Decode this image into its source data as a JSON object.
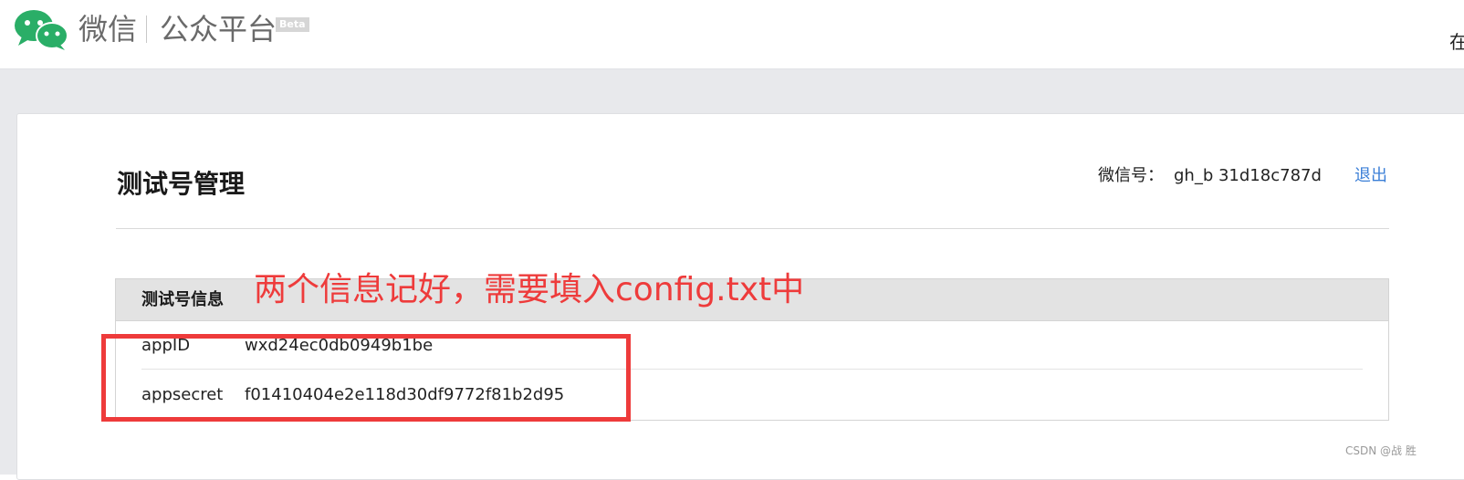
{
  "header": {
    "brand_weixin": "微信",
    "brand_platform": "公众平台",
    "beta_label": "Beta",
    "top_right_text": "在"
  },
  "page": {
    "title": "测试号管理",
    "wechat_id_label": "微信号：",
    "wechat_id_value": "gh_b  31d18c787d",
    "logout_label": "退出"
  },
  "info_panel": {
    "title": "测试号信息",
    "rows": [
      {
        "label": "appID",
        "value": "wxd24ec0db0949b1be"
      },
      {
        "label": "appsecret",
        "value": "f01410404e2e118d30df9772f81b2d95"
      }
    ]
  },
  "annotation": {
    "text": "两个信息记好，需要填入config.txt中",
    "color": "#ee3b3b"
  },
  "watermark": "CSDN @战 胜",
  "colors": {
    "link": "#3b7fd7",
    "wechat_green": "#2aae67",
    "page_bg": "#e8e9ec"
  },
  "icons": {
    "logo": "wechat-logo-icon"
  }
}
